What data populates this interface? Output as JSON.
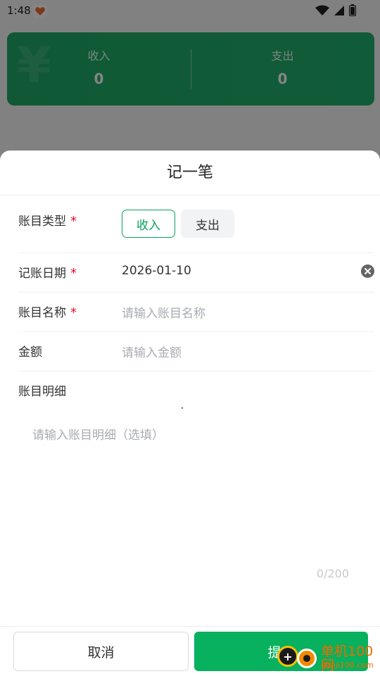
{
  "status_bar": {
    "time": "1:48"
  },
  "summary": {
    "income_label": "收入",
    "income_value": "0",
    "expense_label": "支出",
    "expense_value": "0"
  },
  "sheet": {
    "title": "记一笔",
    "type_row": {
      "label": "账目类型",
      "required_mark": "*",
      "options": [
        "收入",
        "支出"
      ],
      "selected": "收入"
    },
    "date_row": {
      "label": "记账日期",
      "required_mark": "*",
      "value": "2026-01-10"
    },
    "name_row": {
      "label": "账目名称",
      "required_mark": "*",
      "placeholder": "请输入账目名称"
    },
    "amount_row": {
      "label": "金额",
      "placeholder": "请输入金额"
    },
    "detail_row": {
      "label": "账目明细",
      "placeholder": "请输入账目明细（选填）",
      "count": "0/200"
    },
    "footer": {
      "cancel_label": "取消",
      "submit_label": "提交"
    }
  },
  "watermark": {
    "text": "单机100网",
    "sub": "danji100.com"
  },
  "colors": {
    "accent": "#07b15e",
    "required": "#ee0a24",
    "card": "#22b06c"
  }
}
